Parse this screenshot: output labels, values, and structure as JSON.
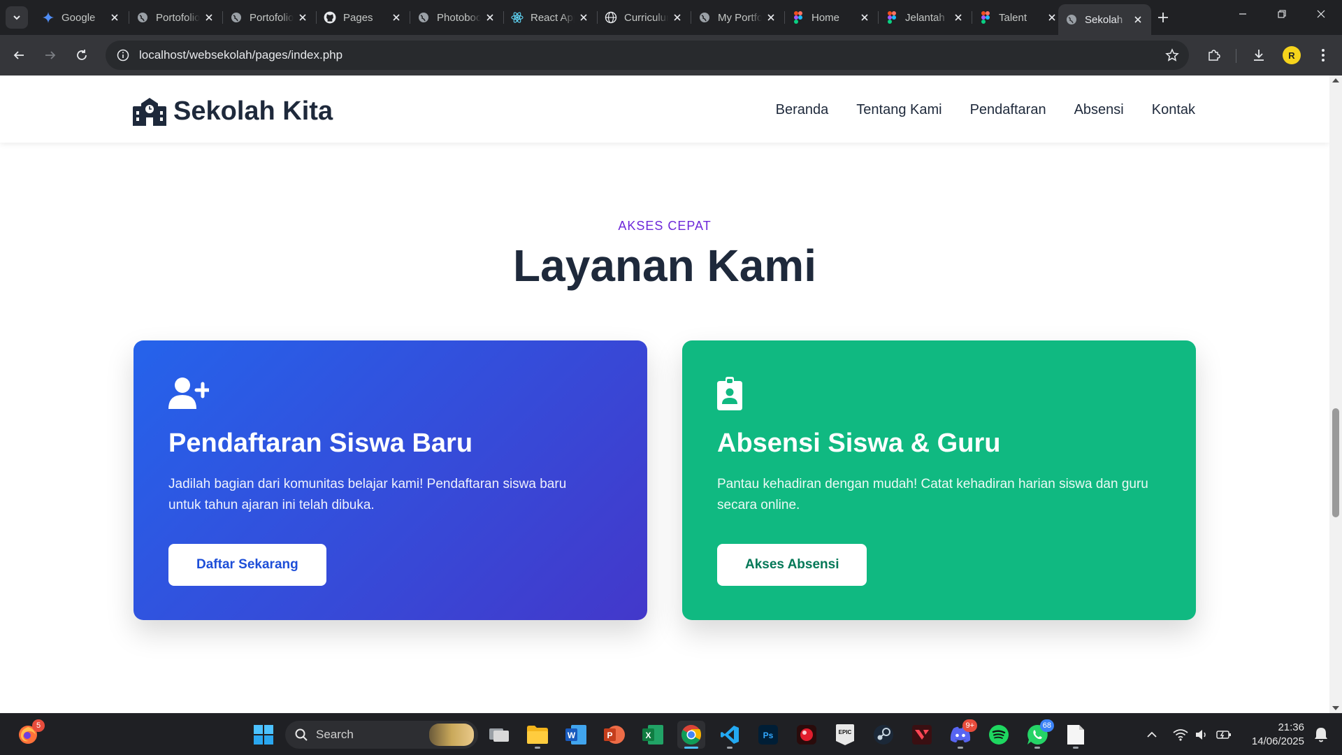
{
  "browser": {
    "tabs": [
      {
        "title": "Google",
        "icon": "gemini-icon"
      },
      {
        "title": "Portofolio",
        "icon": "globe-icon"
      },
      {
        "title": "Portofolio",
        "icon": "globe-icon"
      },
      {
        "title": "Pages",
        "icon": "github-icon"
      },
      {
        "title": "Photobooth",
        "icon": "globe-icon"
      },
      {
        "title": "React App",
        "icon": "react-icon"
      },
      {
        "title": "Curriculum",
        "icon": "web-icon"
      },
      {
        "title": "My Portfolio",
        "icon": "globe-icon"
      },
      {
        "title": "Home",
        "icon": "figma-icon"
      },
      {
        "title": "Jelantah",
        "icon": "figma-icon"
      },
      {
        "title": "Talent",
        "icon": "figma-icon"
      },
      {
        "title": "Sekolah",
        "icon": "globe-icon"
      }
    ],
    "active_tab_index": 11,
    "url": "localhost/websekolah/pages/index.php",
    "profile_initial": "R"
  },
  "site": {
    "brand": "Sekolah Kita",
    "nav": [
      "Beranda",
      "Tentang Kami",
      "Pendaftaran",
      "Absensi",
      "Kontak"
    ],
    "section": {
      "eyebrow": "AKSES CEPAT",
      "title": "Layanan Kami"
    },
    "cards": [
      {
        "title": "Pendaftaran Siswa Baru",
        "description": "Jadilah bagian dari komunitas belajar kami! Pendaftaran siswa baru untuk tahun ajaran ini telah dibuka.",
        "button": "Daftar Sekarang",
        "icon": "user-plus-icon"
      },
      {
        "title": "Absensi Siswa & Guru",
        "description": "Pantau kehadiran dengan mudah! Catat kehadiran harian siswa dan guru secara online.",
        "button": "Akses Absensi",
        "icon": "id-badge-icon"
      }
    ]
  },
  "taskbar": {
    "search_placeholder": "Search",
    "firefox_badge": "5",
    "discord_badge": "9+",
    "whatsapp_badge": "68",
    "time": "21:36",
    "date": "14/06/2025"
  },
  "colors": {
    "brand_text": "#1e293b",
    "eyebrow": "#6d28d9",
    "card_blue_start": "#2563eb",
    "card_blue_end": "#4338ca",
    "card_green": "#10b981"
  }
}
